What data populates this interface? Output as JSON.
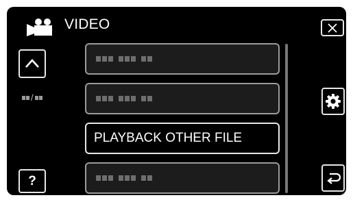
{
  "header": {
    "mode_icon": "video-camera-icon",
    "title": "VIDEO"
  },
  "buttons": {
    "close_icon": "close-icon",
    "up_icon": "chevron-up-icon",
    "settings_icon": "gear-icon",
    "help_label": "?",
    "back_icon": "return-arrow-icon"
  },
  "pagination": {
    "separator": "/"
  },
  "menu": {
    "items": [
      {
        "label": "",
        "state": "unavailable"
      },
      {
        "label": "",
        "state": "unavailable"
      },
      {
        "label": "PLAYBACK OTHER FILE",
        "state": "selected"
      },
      {
        "label": "",
        "state": "unavailable"
      }
    ]
  },
  "colors": {
    "background": "#000000",
    "text": "#ffffff",
    "border": "#e8e8e8",
    "inactive_item": "#1c1c1c",
    "placeholder": "#6e6e6e"
  }
}
